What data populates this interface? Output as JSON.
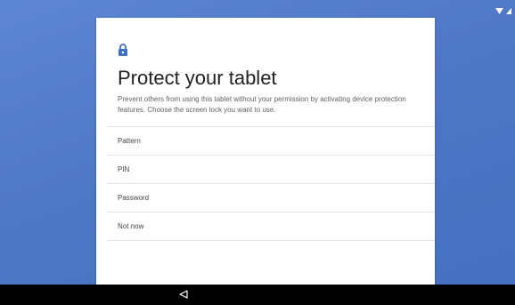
{
  "setup": {
    "title": "Protect your tablet",
    "description": "Prevent others from using this tablet without your permission by activating device protection features. Choose the screen lock you want to use.",
    "options": [
      {
        "label": "Pattern"
      },
      {
        "label": "PIN"
      },
      {
        "label": "Password"
      },
      {
        "label": "Not now"
      }
    ]
  },
  "icons": {
    "header": "lock-icon",
    "status": [
      "wifi-icon",
      "signal-icon"
    ],
    "navigation": "back-icon"
  },
  "colors": {
    "accent": "#3f6fc2",
    "background": "#4e77c6",
    "card": "#ffffff",
    "nav_bar": "#000000"
  }
}
